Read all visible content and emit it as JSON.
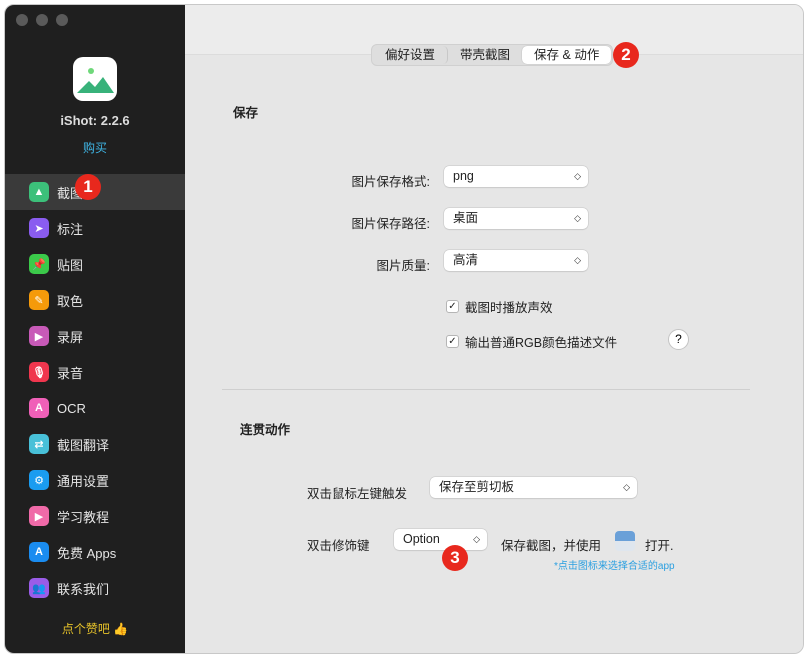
{
  "sidebar": {
    "version": "iShot: 2.2.6",
    "buy": "购买",
    "items": [
      {
        "label": "截图",
        "icon": "screenshot-icon",
        "color": "#3cc07a"
      },
      {
        "label": "标注",
        "icon": "cursor-icon",
        "color": "#8a5cf0"
      },
      {
        "label": "贴图",
        "icon": "pin-icon",
        "color": "#3bc94a"
      },
      {
        "label": "取色",
        "icon": "eyedropper-icon",
        "color": "#f59a0a"
      },
      {
        "label": "录屏",
        "icon": "screen-record-icon",
        "color": "#c85ab8"
      },
      {
        "label": "录音",
        "icon": "microphone-icon",
        "color": "#f0364e"
      },
      {
        "label": "OCR",
        "icon": "ocr-icon",
        "color": "#f060b8"
      },
      {
        "label": "截图翻译",
        "icon": "translate-icon",
        "color": "#48c0d8"
      },
      {
        "label": "通用设置",
        "icon": "gear-icon",
        "color": "#1a9cf0"
      },
      {
        "label": "学习教程",
        "icon": "video-icon",
        "color": "#f06aa8"
      },
      {
        "label": "免费 Apps",
        "icon": "app-store-icon",
        "color": "#1a8cf0"
      },
      {
        "label": "联系我们",
        "icon": "contacts-icon",
        "color": "#9a5ce8"
      }
    ],
    "like": "点个赞吧 👍"
  },
  "badges": [
    "1",
    "2",
    "3"
  ],
  "tabs": [
    {
      "label": "偏好设置"
    },
    {
      "label": "带壳截图"
    },
    {
      "label": "保存 & 动作",
      "selected": true
    }
  ],
  "save": {
    "title": "保存",
    "format_label": "图片保存格式:",
    "format_value": "png",
    "path_label": "图片保存路径:",
    "path_value": "桌面",
    "quality_label": "图片质量:",
    "quality_value": "高清",
    "sound_label": "截图时播放声效",
    "sound_checked": true,
    "rgb_label": "输出普通RGB颜色描述文件",
    "rgb_checked": true,
    "help": "?"
  },
  "actions": {
    "title": "连贯动作",
    "dblclick_label": "双击鼠标左键触发",
    "dblclick_value": "保存至剪切板",
    "modifier_label": "双击修饰键",
    "modifier_value": "Option",
    "save_text": "保存截图，并使用",
    "open_text": "打开.",
    "note": "*点击图标来选择合适的app"
  }
}
